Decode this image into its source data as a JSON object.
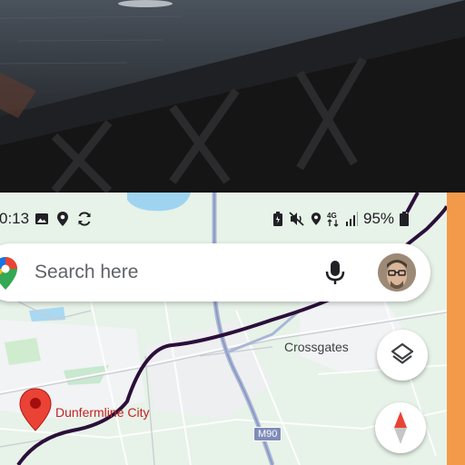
{
  "status_bar": {
    "time": "0:13",
    "battery": "95%",
    "left_icons": [
      "image-icon",
      "location-icon",
      "sync-icon"
    ],
    "right_icons": [
      "battery-saver-icon",
      "mute-icon",
      "location-icon",
      "4g-icon",
      "signal-icon",
      "battery-icon"
    ]
  },
  "search": {
    "placeholder": "Search here"
  },
  "map": {
    "labels": {
      "crossgates": "Crossgates",
      "dunfermline": "Dunfermline City",
      "m90": "M90"
    }
  },
  "colors": {
    "map_bg": "#e7f2e8",
    "route": "#2b0f3a",
    "pin": "#ea4335",
    "label_red": "#c5221f",
    "side_strip": "#f39a4a"
  }
}
